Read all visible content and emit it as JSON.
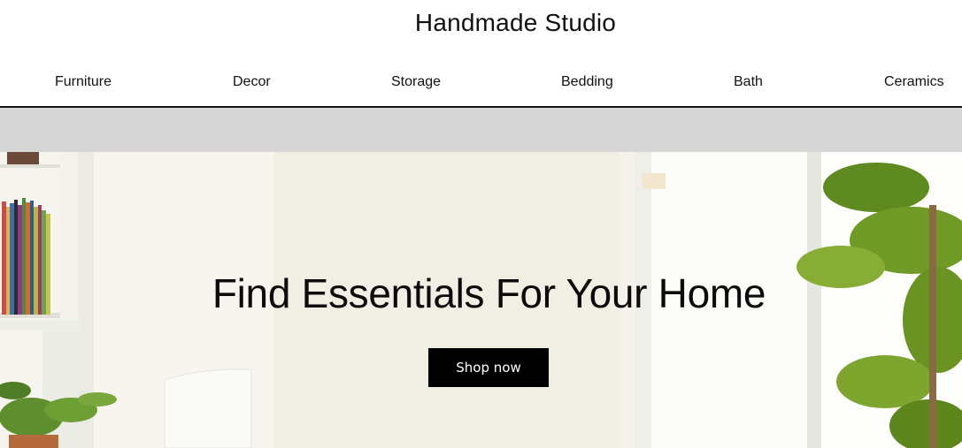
{
  "header": {
    "title": "Handmade Studio"
  },
  "nav": {
    "items": [
      {
        "label": "Furniture"
      },
      {
        "label": "Decor"
      },
      {
        "label": "Storage"
      },
      {
        "label": "Bedding"
      },
      {
        "label": "Bath"
      },
      {
        "label": "Ceramics"
      }
    ]
  },
  "hero": {
    "heading": "Find Essentials For Your Home",
    "button_label": "Shop now",
    "image_description_icon": "living-room-photo"
  },
  "colors": {
    "header_border": "#111111",
    "band": "#d6d6d6",
    "button_bg": "#000000",
    "button_text": "#ffffff"
  }
}
